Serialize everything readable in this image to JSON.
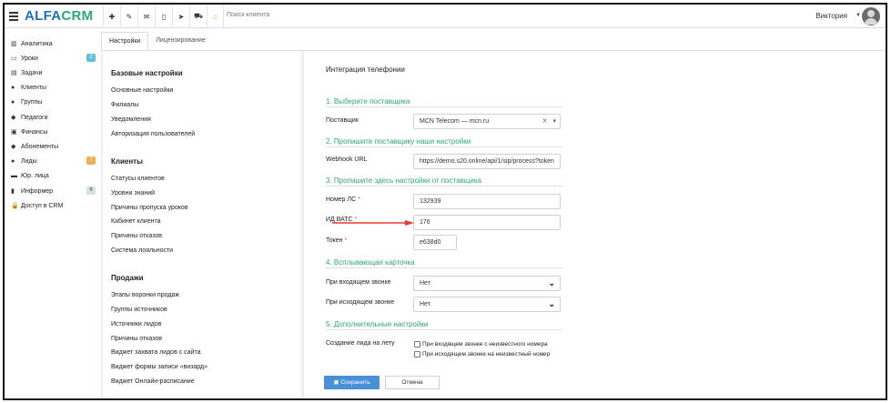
{
  "app": {
    "logo_alfa": "ALFA",
    "logo_crm": "CRM"
  },
  "topbar": {
    "icons": [
      "plus-icon",
      "wrench-icon",
      "envelope-icon",
      "phone-icon",
      "send-icon",
      "cart-icon",
      "bell-icon"
    ],
    "search_placeholder": "Поиск клиента",
    "user_name": "Виктория"
  },
  "sidebar": {
    "items": [
      {
        "label": "Аналитика",
        "icon": "chart-icon",
        "glyph": "▥"
      },
      {
        "label": "Уроки",
        "icon": "calendar-icon",
        "glyph": "▭",
        "badge": "2",
        "badge_color": "teal"
      },
      {
        "label": "Задачи",
        "icon": "tasks-icon",
        "glyph": "▤"
      },
      {
        "label": "Клиенты",
        "icon": "user-icon",
        "glyph": "●"
      },
      {
        "label": "Группы",
        "icon": "users-icon",
        "glyph": "●"
      },
      {
        "label": "Педагоги",
        "icon": "graduation-icon",
        "glyph": "◆"
      },
      {
        "label": "Финансы",
        "icon": "money-icon",
        "glyph": "▣"
      },
      {
        "label": "Абонементы",
        "icon": "tag-icon",
        "glyph": "◆"
      },
      {
        "label": "Лиды",
        "icon": "lead-icon",
        "glyph": "●",
        "badge": "7",
        "badge_color": "orange"
      },
      {
        "label": "Юр. лица",
        "icon": "building-icon",
        "glyph": "▬"
      },
      {
        "label": "Информер",
        "icon": "book-icon",
        "glyph": "▮",
        "badge": "6",
        "badge_color": "green"
      },
      {
        "label": "Доступ в CRM",
        "icon": "lock-icon",
        "glyph": "🔒"
      }
    ]
  },
  "tabs": [
    {
      "label": "Настройки",
      "active": true
    },
    {
      "label": "Лицензирование",
      "active": false
    }
  ],
  "settings_menu": {
    "base": {
      "title": "Базовые настройки",
      "links": [
        "Основные настройки",
        "Филиалы",
        "Уведомления",
        "Авторизация пользователей"
      ]
    },
    "clients": {
      "title": "Клиенты",
      "links": [
        "Статусы клиентов",
        "Уровни знаний",
        "Причины пропуска уроков",
        "Кабинет клиента",
        "Причины отказов",
        "Система лояльности"
      ]
    },
    "sales": {
      "title": "Продажи",
      "links": [
        "Этапы воронки продаж",
        "Группы источников",
        "Источники лидов",
        "Причины отказов",
        "Виджет захвата лидов с сайта",
        "Виджет формы записи «визард»",
        "Виджет Онлайн-расписание"
      ]
    }
  },
  "form": {
    "title": "Интеграция телефонии",
    "sec1": "1. Выберите поставщика",
    "provider_label": "Поставщик",
    "provider_value": "MCN Telecom — mcn.ru",
    "sec2": "2. Пропишите поставщику наши настройки",
    "webhook_label": "Webhook URL",
    "webhook_value": "https://demo.s20.online/api/1/sip/process?token",
    "sec3": "3. Пропишите здесь настройки от поставщика",
    "ls_label": "Номер ЛС",
    "ls_value": "132939",
    "vats_label": "ИД ВАТС",
    "vats_value": "176",
    "token_label": "Токен",
    "token_value": "e638d0",
    "req_mark": "*",
    "sec4": "4. Всплывающая карточка",
    "incoming_label": "При входящем звонке",
    "incoming_value": "Нет",
    "outgoing_label": "При исходящем звонке",
    "outgoing_value": "Нет",
    "sec5": "5. Дополнительные настройки",
    "lead_label": "Создание лида на лету",
    "cb_incoming": "При входящем звонке с неизвестного номера",
    "cb_outgoing": "При исходящем звонке на неизвестный номер",
    "save_label": "Сохранить",
    "cancel_label": "Отмена"
  },
  "colors": {
    "brand_blue": "#1f6fc0",
    "brand_green": "#2aa87c",
    "save_button": "#4a90d9",
    "annotation_arrow": "#e53935"
  }
}
